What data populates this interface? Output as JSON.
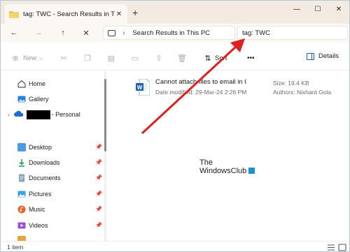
{
  "tab": {
    "title": "tag: TWC - Search Results in This PC"
  },
  "address": {
    "location": "Search Results in This PC",
    "search_query": "tag: TWC"
  },
  "commandbar": {
    "new_label": "New",
    "sort_label": "Sort",
    "details_label": "Details",
    "more_label": "•••"
  },
  "sidebar": {
    "items": [
      {
        "label": "Home",
        "icon": "home-icon",
        "pinned": false
      },
      {
        "label": "Gallery",
        "icon": "gallery-icon",
        "pinned": false
      },
      {
        "label": "- Personal",
        "icon": "onedrive-icon",
        "pinned": false
      },
      {
        "label": "Desktop",
        "icon": "desktop-icon",
        "pinned": true
      },
      {
        "label": "Downloads",
        "icon": "downloads-icon",
        "pinned": true
      },
      {
        "label": "Documents",
        "icon": "documents-icon",
        "pinned": true
      },
      {
        "label": "Pictures",
        "icon": "pictures-icon",
        "pinned": true
      },
      {
        "label": "Music",
        "icon": "music-icon",
        "pinned": true
      },
      {
        "label": "Videos",
        "icon": "videos-icon",
        "pinned": true
      }
    ]
  },
  "file": {
    "name": "Cannot attach files to email in Ou...",
    "date_modified": "Date modified: 29-Mar-24 2:26 PM",
    "size": "Size: 19.4 KB",
    "authors": "Authors: Nishant Gola"
  },
  "watermark": {
    "line1": "The",
    "line2": "WindowsClub"
  },
  "status": {
    "count": "1 item"
  },
  "colors": {
    "accent": "#1b5fb4",
    "arrow": "#e02020",
    "titlebar": "#f3ebe2"
  }
}
